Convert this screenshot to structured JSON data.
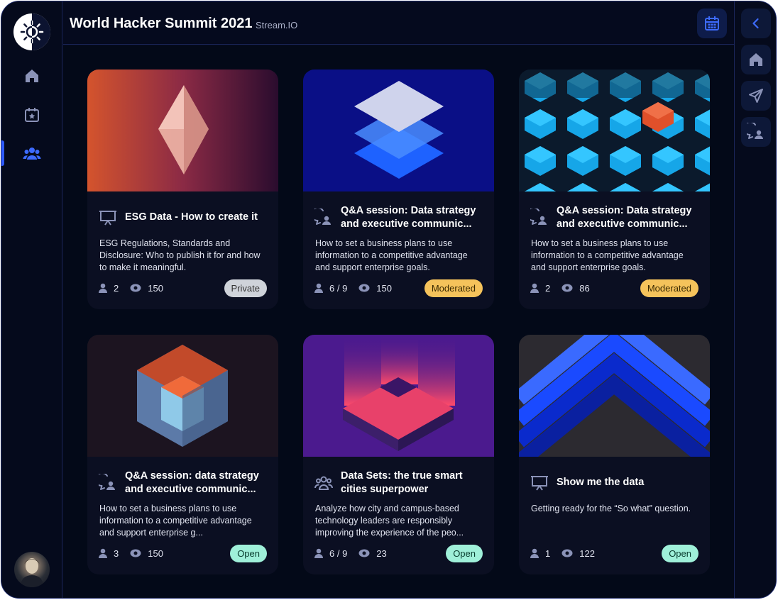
{
  "header": {
    "title": "World Hacker Summit 2021",
    "subtitle": "Stream.IO"
  },
  "icons": {
    "logo": "sun-icon",
    "left_nav": [
      "home-icon",
      "calendar-star-icon",
      "users-icon"
    ],
    "header_action": "calendar-icon",
    "right_nav": [
      "chevron-left-icon",
      "home-icon",
      "send-icon",
      "chat-user-icon"
    ]
  },
  "colors": {
    "accent": "#2f5bff",
    "private": "#cfd3da",
    "moderated": "#f5c35b",
    "open": "#9ff0d9"
  },
  "cards": [
    {
      "title": "ESG Data - How to create it",
      "description": "ESG Regulations, Standards and Disclosure: Who to publish it for and how to make it meaningful.",
      "participants": "2",
      "views": "150",
      "status": "Private",
      "icon": "presentation-icon"
    },
    {
      "title": "Q&A session: Data strategy and executive communic...",
      "description": "How to set a business plans to use information to a competitive advantage and support enterprise goals.",
      "participants": "6 / 9",
      "views": "150",
      "status": "Moderated",
      "icon": "chat-user-icon"
    },
    {
      "title": "Q&A session: Data strategy and executive communic...",
      "description": "How to set a business plans to use information to a competitive advantage and support enterprise goals.",
      "participants": "2",
      "views": "86",
      "status": "Moderated",
      "icon": "chat-user-icon"
    },
    {
      "title": "Q&A session: data strategy and executive communic...",
      "description": "How to set a business plans to use information to a competitive advantage and support enterprise g...",
      "participants": "3",
      "views": "150",
      "status": "Open",
      "icon": "chat-user-icon"
    },
    {
      "title": "Data Sets: the true smart cities superpower",
      "description": "Analyze how city and campus-based technology leaders are responsibly improving the experience of the peo...",
      "participants": "6 / 9",
      "views": "23",
      "status": "Open",
      "icon": "users-icon"
    },
    {
      "title": "Show me the data",
      "description": "Getting ready for the “So what” question.",
      "participants": "1",
      "views": "122",
      "status": "Open",
      "icon": "presentation-icon"
    }
  ]
}
